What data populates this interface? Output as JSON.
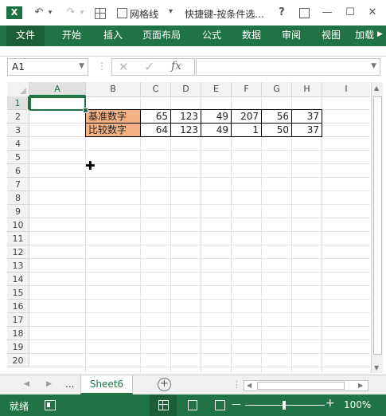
{
  "titlebar": {
    "app_icon_letter": "X",
    "gridlines_label": "网格线",
    "title": "快捷键-按条件选...",
    "help": "?",
    "min": "—",
    "max": "☐",
    "close": "✕",
    "undo": "↶",
    "redo": "↷",
    "dropdown": "▾"
  },
  "ribbon": {
    "tabs": [
      "文件",
      "开始",
      "插入",
      "页面布局",
      "公式",
      "数据",
      "审阅",
      "视图",
      "加载"
    ]
  },
  "formula_bar": {
    "namebox": "A1",
    "fx": "fx",
    "cancel": "✕",
    "enter": "✓",
    "value": ""
  },
  "sheet": {
    "columns": [
      "A",
      "B",
      "C",
      "D",
      "E",
      "F",
      "G",
      "H",
      "I"
    ],
    "rows": [
      "1",
      "2",
      "3",
      "4",
      "5",
      "6",
      "7",
      "8",
      "9",
      "10",
      "11",
      "12",
      "13",
      "14",
      "15",
      "16",
      "17",
      "18",
      "19",
      "20"
    ],
    "row2": {
      "label": "基准数字",
      "values": [
        "65",
        "123",
        "49",
        "207",
        "56",
        "37"
      ]
    },
    "row3": {
      "label": "比较数字",
      "values": [
        "64",
        "123",
        "49",
        "1",
        "50",
        "37"
      ]
    },
    "label_fill": "#f4b183",
    "cursor": "✚"
  },
  "sheet_tabs": {
    "prev": "◀",
    "next": "▶",
    "ellipsis": "...",
    "active": "Sheet6",
    "add": "+"
  },
  "status": {
    "ready": "就绪",
    "zoom": "100%",
    "zoom_minus": "—",
    "zoom_plus": "+"
  },
  "colors": {
    "accent": "#217346"
  }
}
